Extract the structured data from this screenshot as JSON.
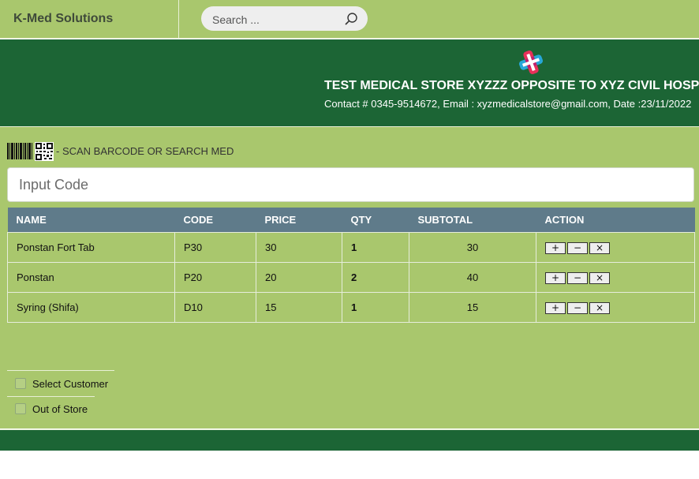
{
  "header": {
    "brand": "K-Med Solutions",
    "search_placeholder": "Search ..."
  },
  "banner": {
    "store_name": "TEST MEDICAL STORE XYZZZ OPPOSITE TO XYZ CIVIL HOSPITAL",
    "contact": "Contact # 0345-9514672, Email : xyzmedicalstore@gmail.com, Date :23/11/2022"
  },
  "scan": {
    "label": "- SCAN BARCODE OR SEARCH MED",
    "input_placeholder": "Input Code"
  },
  "table": {
    "columns": [
      "NAME",
      "CODE",
      "PRICE",
      "QTY",
      "SUBTOTAL",
      "ACTION"
    ],
    "rows": [
      {
        "name": "Ponstan Fort Tab",
        "code": "P30",
        "price": "30",
        "qty": "1",
        "subtotal": "30"
      },
      {
        "name": "Ponstan",
        "code": "P20",
        "price": "20",
        "qty": "2",
        "subtotal": "40"
      },
      {
        "name": "Syring (Shifa)",
        "code": "D10",
        "price": "15",
        "qty": "1",
        "subtotal": "15"
      }
    ],
    "action_labels": {
      "increase": "+",
      "decrease": "−",
      "remove": "×"
    }
  },
  "options": {
    "select_customer": "Select Customer",
    "out_of_store": "Out of Store"
  },
  "colors": {
    "page_green": "#a9c76d",
    "banner_green": "#1c6535",
    "table_header": "#5f7b8a"
  },
  "icons": {
    "search": "search-icon",
    "logo": "medical-cross-logo",
    "barcode": "barcode-icon",
    "qr": "qr-code-icon"
  }
}
